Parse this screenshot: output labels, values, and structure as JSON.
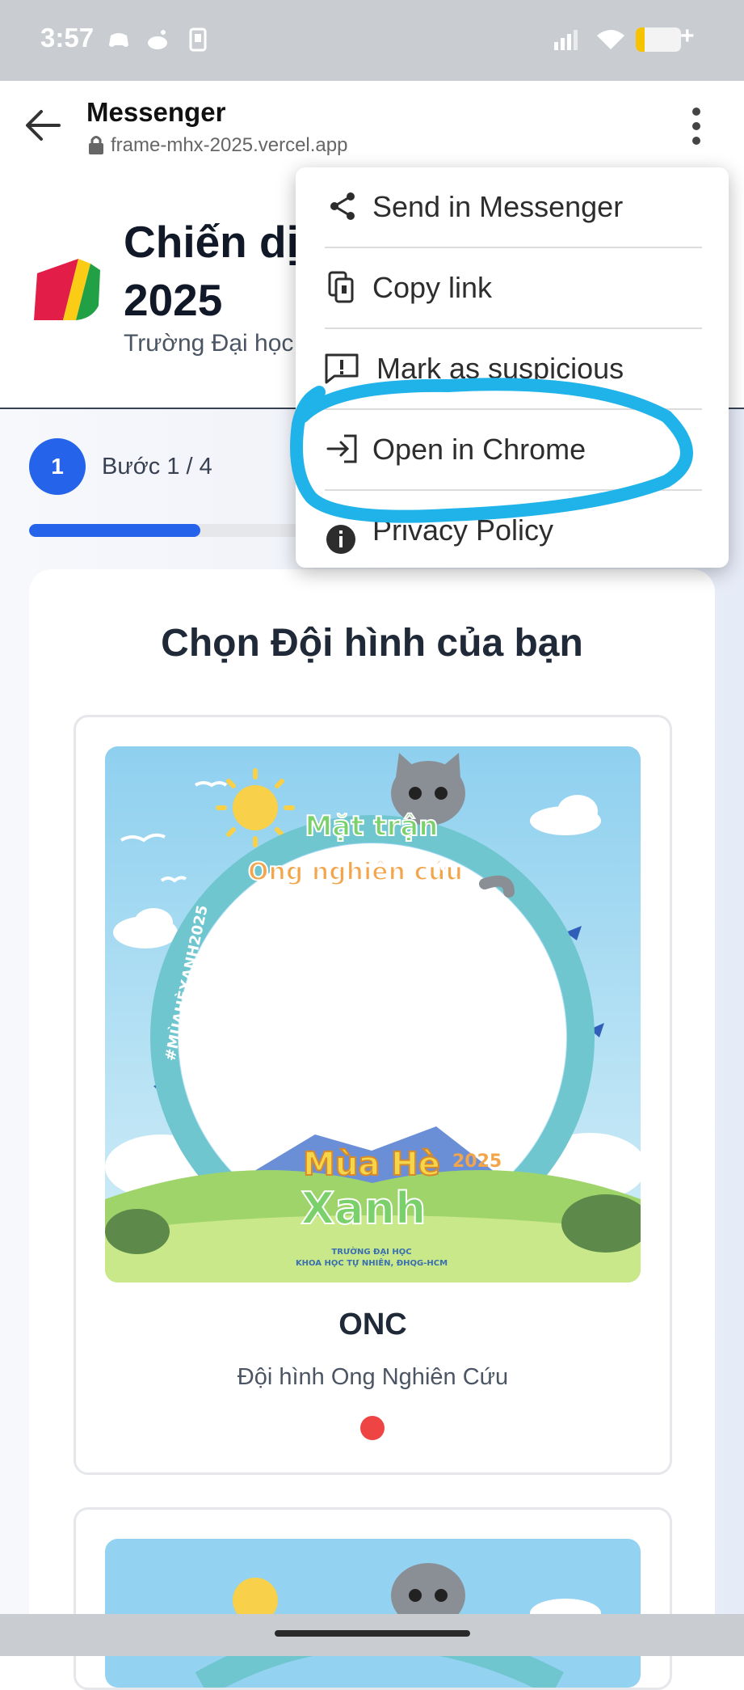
{
  "status_bar": {
    "time": "3:57",
    "battery_level": 0.2
  },
  "browser": {
    "title": "Messenger",
    "url": "frame-mhx-2025.vercel.app",
    "menu": {
      "items": [
        {
          "label": "Send in Messenger",
          "icon": "share-icon"
        },
        {
          "label": "Copy link",
          "icon": "copy-link-icon"
        },
        {
          "label": "Mark as suspicious",
          "icon": "report-icon"
        },
        {
          "label": "Open in Chrome",
          "icon": "open-external-icon"
        },
        {
          "label": "Privacy Policy",
          "icon": "info-icon"
        }
      ]
    }
  },
  "page": {
    "title_line1": "Chiến dịch",
    "title_line2": "2025",
    "subtitle": "Trường Đại học",
    "step": {
      "number": "1",
      "label": "Bước 1 / 4",
      "progress": 0.25
    },
    "section_title": "Chọn Đội hình của bạn",
    "teams": [
      {
        "code": "ONC",
        "description": "Đội hình Ong Nghiên Cứu",
        "frame_text": {
          "top_line1": "Mặt trận",
          "top_line2": "Ong nghiên cứu",
          "side_hashtag": "#MÙAHÈXANH2025",
          "bottom_line1": "Mùa Hè",
          "bottom_line2": "Xanh",
          "year": "2025",
          "school_line1": "TRƯỜNG ĐẠI HỌC",
          "school_line2": "KHOA HỌC TỰ NHIÊN, ĐHQG-HCM"
        }
      }
    ]
  },
  "colors": {
    "accent": "#2563eb",
    "highlight": "#1fb3ea",
    "dot": "#ef4444"
  }
}
